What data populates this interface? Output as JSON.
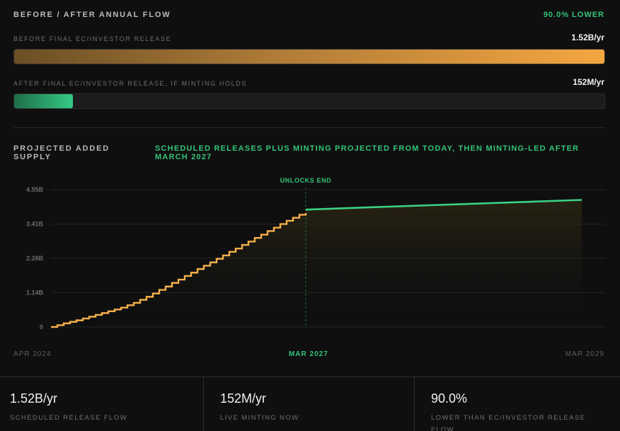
{
  "header": {
    "title": "BEFORE / AFTER ANNUAL FLOW",
    "badge": "90.0% LOWER"
  },
  "flow_bars": {
    "before": {
      "label": "BEFORE FINAL EC/INVESTOR RELEASE",
      "value": "1.52B/yr",
      "fill_fraction": 1.0
    },
    "after": {
      "label": "AFTER FINAL EC/INVESTOR RELEASE, IF MINTING HOLDS",
      "value": "152M/yr",
      "fill_fraction": 0.1
    }
  },
  "projection": {
    "title": "PROJECTED ADDED SUPPLY",
    "subtitle": "SCHEDULED RELEASES PLUS MINTING PROJECTED FROM TODAY, THEN MINTING-LED AFTER MARCH 2027"
  },
  "chart_data": {
    "type": "line",
    "y_ticks": [
      "4.55B",
      "3.41B",
      "2.28B",
      "1.14B",
      "0"
    ],
    "ylim": [
      0,
      4.55
    ],
    "x_labels": [
      "APR 2024",
      "MAR 2027",
      "MAR 2029"
    ],
    "annotation": "UNLOCKS END",
    "series": [
      {
        "step_points": [
          [
            0.0,
            0.0
          ],
          [
            0.06,
            0.06
          ],
          [
            0.12,
            0.12
          ],
          [
            0.18,
            0.17
          ],
          [
            0.24,
            0.22
          ],
          [
            0.3,
            0.28
          ],
          [
            0.36,
            0.34
          ],
          [
            0.42,
            0.4
          ],
          [
            0.48,
            0.46
          ],
          [
            0.54,
            0.52
          ],
          [
            0.6,
            0.58
          ],
          [
            0.66,
            0.64
          ],
          [
            0.72,
            0.72
          ],
          [
            0.78,
            0.8
          ],
          [
            0.84,
            0.9
          ],
          [
            0.9,
            1.0
          ],
          [
            0.96,
            1.11
          ],
          [
            1.02,
            1.23
          ],
          [
            1.08,
            1.34
          ],
          [
            1.14,
            1.46
          ],
          [
            1.2,
            1.57
          ],
          [
            1.26,
            1.69
          ],
          [
            1.32,
            1.8
          ],
          [
            1.38,
            1.92
          ],
          [
            1.44,
            2.03
          ],
          [
            1.5,
            2.14
          ],
          [
            1.56,
            2.26
          ],
          [
            1.62,
            2.37
          ],
          [
            1.68,
            2.49
          ],
          [
            1.74,
            2.6
          ],
          [
            1.8,
            2.72
          ],
          [
            1.86,
            2.83
          ],
          [
            1.92,
            2.95
          ],
          [
            1.98,
            3.06
          ],
          [
            2.04,
            3.18
          ],
          [
            2.1,
            3.29
          ],
          [
            2.16,
            3.41
          ],
          [
            2.22,
            3.52
          ],
          [
            2.28,
            3.62
          ],
          [
            2.34,
            3.72
          ],
          [
            2.4,
            3.78
          ]
        ],
        "color": "#f5b04b"
      },
      {
        "line_points": [
          [
            2.4,
            3.89
          ],
          [
            5.0,
            4.21
          ]
        ],
        "color": "#3ad184"
      }
    ],
    "x_domain": [
      0,
      5.0
    ],
    "unlock_end_x": 2.4,
    "colors": {
      "step": "#f5b04b",
      "minting": "#3ad184",
      "grid": "#242424",
      "marker": "#1f6e49"
    }
  },
  "stats": [
    {
      "value": "1.52B/yr",
      "label": "SCHEDULED RELEASE FLOW"
    },
    {
      "value": "152M/yr",
      "label": "LIVE MINTING NOW"
    },
    {
      "value": "90.0%",
      "label": "LOWER THAN EC/INVESTOR RELEASE FLOW"
    }
  ]
}
